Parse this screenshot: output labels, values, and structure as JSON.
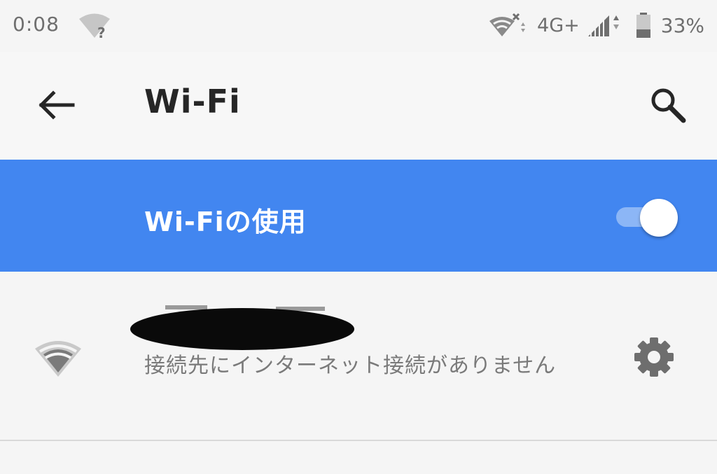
{
  "status_bar": {
    "time": "0:08",
    "network_type": "4G+",
    "battery_percent": "33%",
    "icons": [
      "wifi-question-icon",
      "wifi-x-icon",
      "signal-icon",
      "battery-icon"
    ]
  },
  "app_bar": {
    "title": "Wi-Fi",
    "back_icon": "arrow-left-icon",
    "search_icon": "search-icon"
  },
  "master_switch": {
    "label": "Wi-Fiの使用",
    "enabled": true,
    "accent_color": "#4286f0"
  },
  "networks": [
    {
      "name": "",
      "name_redacted": true,
      "status": "接続先にインターネット接続がありません",
      "icon": "wifi-icon",
      "settings_icon": "gear-icon"
    }
  ]
}
